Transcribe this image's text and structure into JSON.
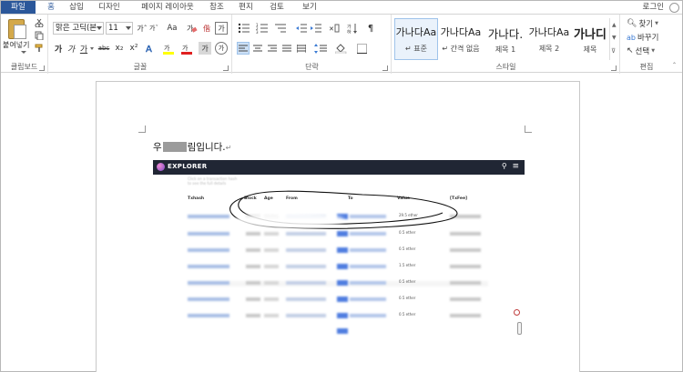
{
  "tabs": [
    {
      "label": "파일"
    },
    {
      "label": "홈"
    },
    {
      "label": "삽입"
    },
    {
      "label": "디자인"
    },
    {
      "label": "페이지 레이아웃"
    },
    {
      "label": "참조"
    },
    {
      "label": "편지"
    },
    {
      "label": "검토"
    },
    {
      "label": "보기"
    }
  ],
  "account": {
    "login": "로그인"
  },
  "clipboard": {
    "paste_label": "붙여넣기",
    "group": "클립보드"
  },
  "font": {
    "name": "맑은 고딕(본",
    "size": "11",
    "aa": "Aa",
    "group": "글꼴",
    "bold": "가",
    "italic": "가",
    "underline": "가",
    "strike": "abc",
    "sub": "x₂",
    "sup": "x²",
    "grow": "가ˆ",
    "shrink": "가ˇ",
    "phonetic": "가",
    "char_border": "가",
    "highlight": "가",
    "font_color": "가",
    "shade": "가",
    "enclose": "가",
    "char_mark": "偕"
  },
  "paragraph": {
    "group": "단락"
  },
  "styles": {
    "group": "스타일",
    "items": [
      {
        "preview": "가나다Aa",
        "name": "↵ 표준"
      },
      {
        "preview": "가나다Aa",
        "name": "↵ 간격 없음"
      },
      {
        "preview": "가나다.",
        "name": "제목 1"
      },
      {
        "preview": "가나다Aa",
        "name": "제목 2"
      },
      {
        "preview": "가나디",
        "name": "제목"
      }
    ]
  },
  "editing": {
    "find": "찾기",
    "replace": "바꾸기",
    "select": "선택",
    "group": "편집"
  },
  "document": {
    "line_start": "우",
    "line_end": "림입니다.",
    "para_mark": "↵"
  },
  "embedded": {
    "title": "EXPLORER",
    "subtitle_1": "Click on a transaction hash",
    "subtitle_2": "to see the full details",
    "headers": [
      "Txhash",
      "Block",
      "Age",
      "From",
      "To",
      "Value",
      "[TxFee]"
    ],
    "value_cells": [
      "29.5 ether",
      "0.5 ether",
      "0.5 ether",
      "1.5 ether",
      "0.5 ether",
      "0.5 ether",
      "0.5 ether"
    ],
    "colors": {
      "bar": "#202634",
      "link": "#4f7de0",
      "scribble": "#111111"
    }
  }
}
